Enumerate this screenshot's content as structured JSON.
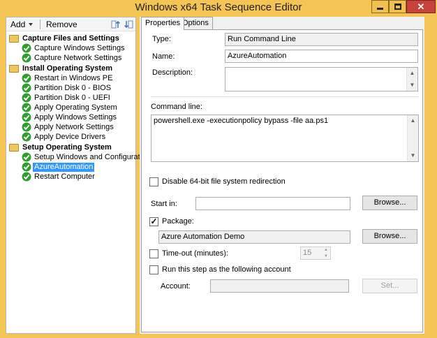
{
  "window": {
    "title": "Windows x64 Task Sequence Editor",
    "close_glyph": "✕"
  },
  "toolbar": {
    "add_label": "Add",
    "remove_label": "Remove"
  },
  "tree": [
    {
      "label": "Capture Files and Settings",
      "type": "group"
    },
    {
      "label": "Capture Windows Settings",
      "type": "step"
    },
    {
      "label": "Capture Network Settings",
      "type": "step"
    },
    {
      "label": "Install Operating System",
      "type": "group"
    },
    {
      "label": "Restart in Windows PE",
      "type": "step"
    },
    {
      "label": "Partition Disk 0 - BIOS",
      "type": "step"
    },
    {
      "label": "Partition Disk 0 - UEFI",
      "type": "step"
    },
    {
      "label": "Apply Operating System",
      "type": "step"
    },
    {
      "label": "Apply Windows Settings",
      "type": "step"
    },
    {
      "label": "Apply Network Settings",
      "type": "step"
    },
    {
      "label": "Apply Device Drivers",
      "type": "step"
    },
    {
      "label": "Setup Operating System",
      "type": "group"
    },
    {
      "label": "Setup Windows and Configuration",
      "type": "step"
    },
    {
      "label": "AzureAutomation",
      "type": "step",
      "selected": true
    },
    {
      "label": "Restart Computer",
      "type": "step"
    }
  ],
  "tabs": {
    "properties": "Properties",
    "options": "Options"
  },
  "properties": {
    "type_label": "Type:",
    "type_value": "Run Command Line",
    "name_label": "Name:",
    "name_value": "AzureAutomation",
    "description_label": "Description:",
    "description_value": "",
    "command_line_label": "Command line:",
    "command_line_value": "powershell.exe -executionpolicy bypass -file aa.ps1",
    "disable_redirection_label": "Disable 64-bit file system redirection",
    "disable_redirection_checked": false,
    "start_in_label": "Start in:",
    "start_in_value": "",
    "browse_label": "Browse...",
    "package_label": "Package:",
    "package_checked": true,
    "package_value": "Azure Automation Demo",
    "timeout_label": "Time-out (minutes):",
    "timeout_checked": false,
    "timeout_value": "15",
    "run_as_label": "Run this step as the following account",
    "run_as_checked": false,
    "account_label": "Account:",
    "account_value": "",
    "set_label": "Set...",
    "check_mark": "✓"
  },
  "colors": {
    "title_bar": "#f4c455",
    "selection": "#3399ff",
    "close_button": "#c7423a"
  },
  "icons": [
    "move-up-icon",
    "move-down-icon",
    "folder-icon",
    "green-check-icon",
    "minimize-icon",
    "maximize-icon",
    "close-icon"
  ]
}
